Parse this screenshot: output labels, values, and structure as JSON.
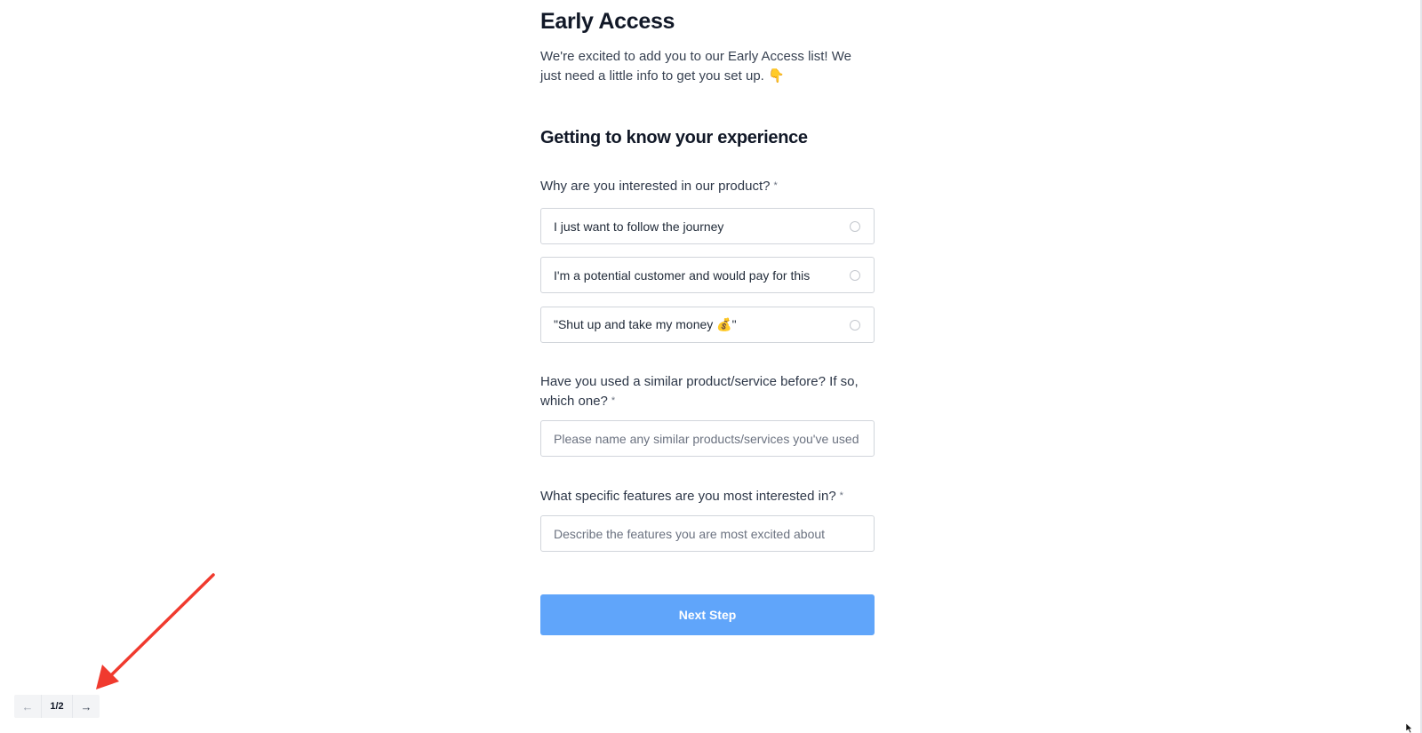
{
  "header": {
    "title": "Early Access",
    "intro": "We're excited to add you to our Early Access list! We just need a little info to get you set up. 👇"
  },
  "section": {
    "title": "Getting to know your experience"
  },
  "questions": {
    "interest": {
      "label": "Why are you interested in our product?",
      "required_marker": "*",
      "options": [
        "I just want to follow the journey",
        "I'm a potential customer and would pay for this",
        "\"Shut up and take my money 💰\""
      ]
    },
    "similar": {
      "label": "Have you used a similar product/service before? If so, which one?",
      "required_marker": "*",
      "placeholder": "Please name any similar products/services you've used",
      "value": ""
    },
    "features": {
      "label": "What specific features are you most interested in?",
      "required_marker": "*",
      "placeholder": "Describe the features you are most excited about",
      "value": ""
    }
  },
  "actions": {
    "next_label": "Next Step"
  },
  "pager": {
    "prev_icon": "arrow-left-icon",
    "next_icon": "arrow-right-icon",
    "prev_glyph": "←",
    "next_glyph": "→",
    "count": "1/2"
  },
  "colors": {
    "accent": "#60a5fa",
    "annotation_arrow": "#f03a2e"
  }
}
